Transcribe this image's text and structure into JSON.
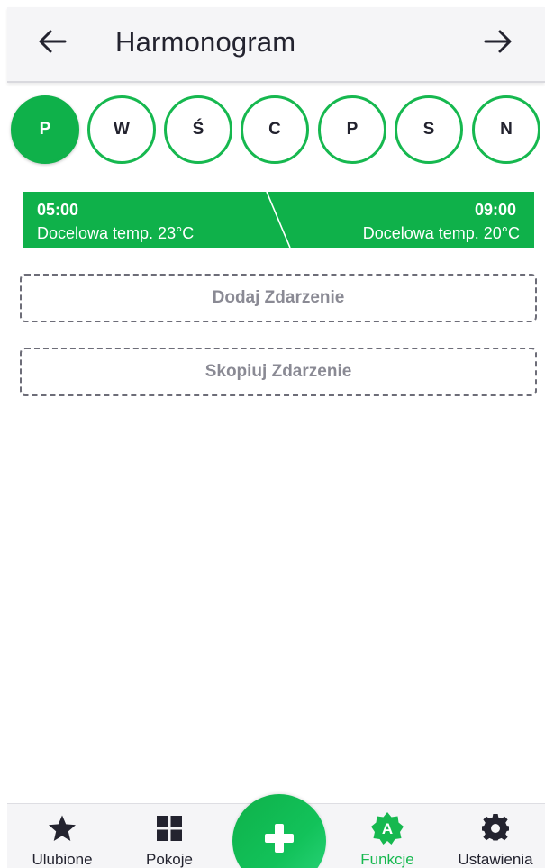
{
  "header": {
    "title": "Harmonogram",
    "back_icon": "arrow-left-icon",
    "forward_icon": "arrow-right-icon"
  },
  "days": [
    {
      "label": "P",
      "active": true
    },
    {
      "label": "W",
      "active": false
    },
    {
      "label": "Ś",
      "active": false
    },
    {
      "label": "C",
      "active": false
    },
    {
      "label": "P",
      "active": false
    },
    {
      "label": "S",
      "active": false
    },
    {
      "label": "N",
      "active": false
    }
  ],
  "event": {
    "start_time": "05:00",
    "start_temp": "Docelowa temp.  23°C",
    "end_time": "09:00",
    "end_temp": "Docelowa temp.  20°C"
  },
  "actions": {
    "add_label": "Dodaj Zdarzenie",
    "copy_label": "Skopiuj Zdarzenie"
  },
  "bottom_nav": {
    "items": [
      {
        "label": "Ulubione",
        "icon": "star-icon"
      },
      {
        "label": "Pokoje",
        "icon": "grid-icon"
      },
      {
        "label": "Funkcje",
        "icon": "automation-a-icon",
        "active": true
      },
      {
        "label": "Ustawienia",
        "icon": "gear-icon"
      }
    ],
    "fab_icon": "plus-icon",
    "automation_letter": "A"
  },
  "colors": {
    "accent": "#0fb14a",
    "text": "#23232f",
    "muted": "#8a8a94",
    "header_bg": "#f5f5f7"
  }
}
